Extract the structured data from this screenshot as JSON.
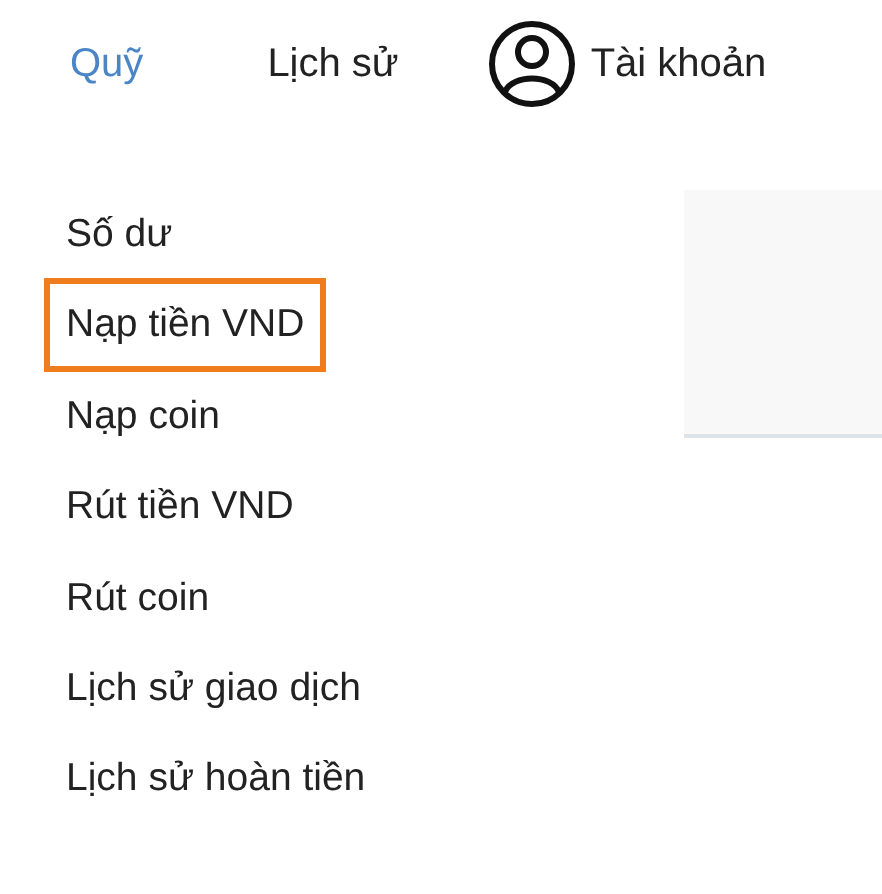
{
  "nav": [
    {
      "label": "Quỹ",
      "selected": true,
      "kind": "text"
    },
    {
      "label": "Lịch sử",
      "selected": false,
      "kind": "text"
    },
    {
      "label": "Tài khoản",
      "selected": false,
      "kind": "account"
    }
  ],
  "menu": [
    {
      "label": "Số dư",
      "selected": false
    },
    {
      "label": "Nạp tiền VND",
      "selected": true
    },
    {
      "label": "Nạp coin",
      "selected": false
    },
    {
      "label": "Rút tiền VND",
      "selected": false
    },
    {
      "label": "Rút coin",
      "selected": false
    },
    {
      "label": "Lịch sử giao dịch",
      "selected": false
    },
    {
      "label": "Lịch sử hoàn tiền",
      "selected": false
    }
  ]
}
